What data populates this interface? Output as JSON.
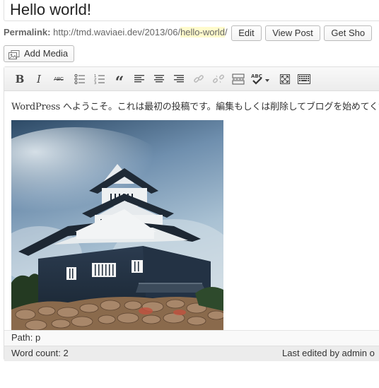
{
  "post": {
    "title": "Hello world!"
  },
  "permalink": {
    "label": "Permalink:",
    "base_url": "http://tmd.waviaei.dev/2013/06/",
    "slug": "hello-world",
    "trailing": "/",
    "edit_label": "Edit",
    "view_label": "View Post",
    "shortlink_label": "Get Sho"
  },
  "media": {
    "add_label": "Add Media"
  },
  "toolbar": {
    "buttons": [
      "bold",
      "italic",
      "strikethrough",
      "bulleted-list",
      "numbered-list",
      "blockquote",
      "align-left",
      "align-center",
      "align-right",
      "insert-link",
      "remove-link",
      "insert-more",
      "spellcheck",
      "fullscreen",
      "kitchen-sink"
    ],
    "bold_glyph": "B",
    "italic_glyph": "I",
    "strike_glyph": "ABC",
    "quote_glyph": "“",
    "spell_glyph": "ABC"
  },
  "content": {
    "paragraph": "WordPress へようこそ。これは最初の投稿です。編集もしくは削除してブログを始めてくだ"
  },
  "footer": {
    "path": "Path: p",
    "word_count": "Word count: 2",
    "last_edited": "Last edited by admin o"
  },
  "colors": {
    "slug_highlight": "#fffbcc",
    "toolbar_bg": "#ececec",
    "status_bg": "#ececec"
  }
}
